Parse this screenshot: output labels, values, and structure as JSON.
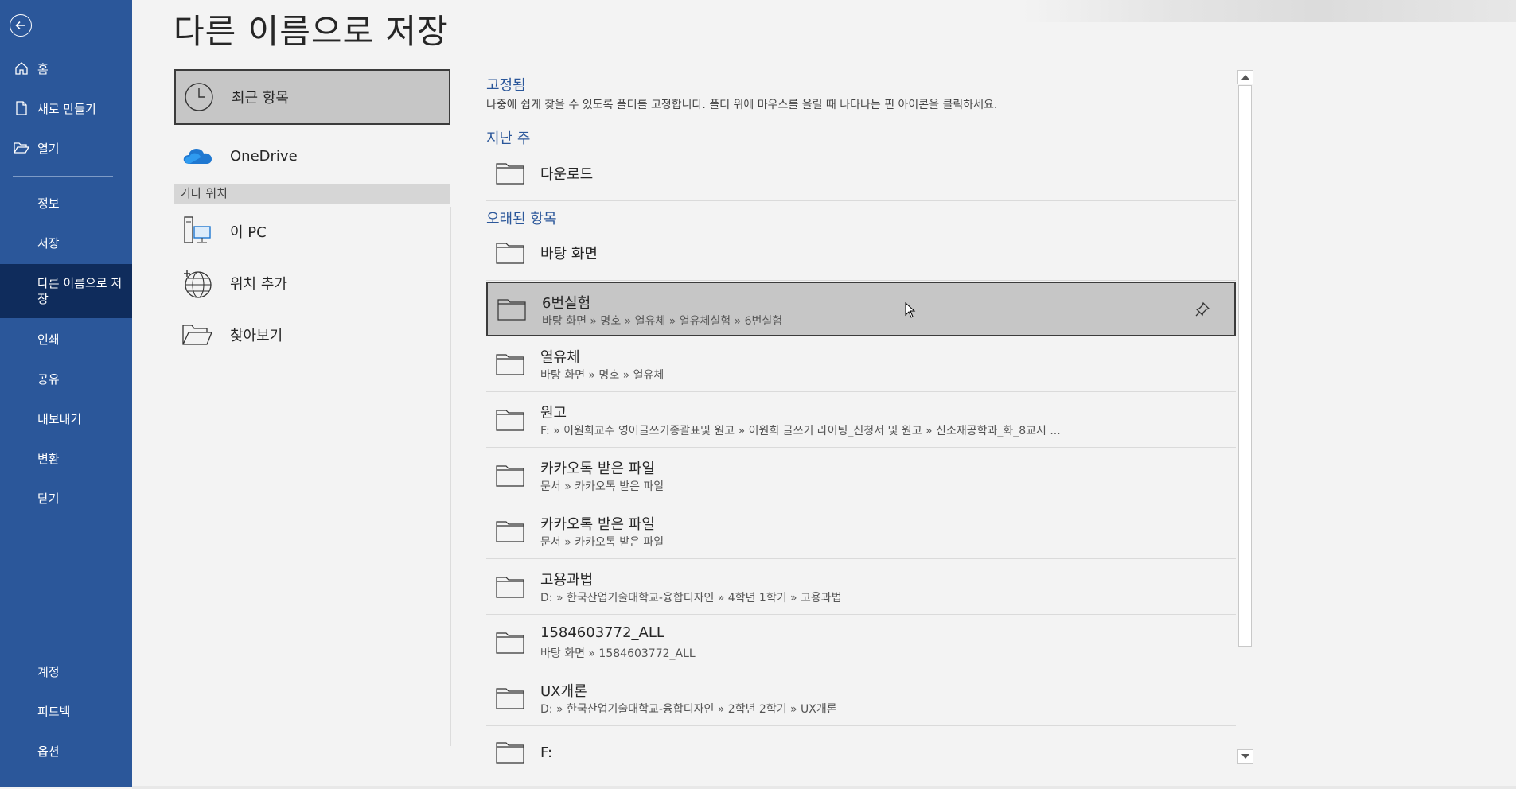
{
  "page": {
    "title": "다른 이름으로 저장"
  },
  "nav": {
    "back_icon": "back-arrow-icon",
    "items_top": [
      {
        "label": "홈",
        "icon": "home-icon"
      },
      {
        "label": "새로 만들기",
        "icon": "new-document-icon"
      },
      {
        "label": "열기",
        "icon": "open-folder-icon"
      }
    ],
    "items_mid": [
      {
        "label": "정보"
      },
      {
        "label": "저장"
      },
      {
        "label": "다른 이름으로 저장",
        "active": true
      },
      {
        "label": "인쇄"
      },
      {
        "label": "공유"
      },
      {
        "label": "내보내기"
      },
      {
        "label": "변환"
      },
      {
        "label": "닫기"
      }
    ],
    "items_bottom": [
      {
        "label": "계정"
      },
      {
        "label": "피드백"
      },
      {
        "label": "옵션"
      }
    ]
  },
  "locations": {
    "recent": {
      "label": "최근 항목",
      "icon": "clock-icon"
    },
    "onedrive": {
      "label": "OneDrive",
      "icon": "onedrive-cloud-icon"
    },
    "other_header": "기타 위치",
    "this_pc": {
      "label": "이 PC",
      "icon": "pc-icon"
    },
    "add_place": {
      "label": "위치 추가",
      "icon": "globe-add-icon"
    },
    "browse": {
      "label": "찾아보기",
      "icon": "folder-open-icon"
    }
  },
  "recent": {
    "pinned_title": "고정됨",
    "pinned_desc": "나중에 쉽게 찾을 수 있도록 폴더를 고정합니다. 폴더 위에 마우스를 올릴 때 나타나는 핀 아이콘을 클릭하세요.",
    "last_week_title": "지난 주",
    "older_title": "오래된 항목",
    "last_week": [
      {
        "name": "다운로드"
      }
    ],
    "older": [
      {
        "name": "바탕 화면"
      },
      {
        "name": "6번실험",
        "path": "바탕 화면 » 명호 » 열유체 » 열유체실험 » 6번실험",
        "hover": true
      },
      {
        "name": "열유체",
        "path": "바탕 화면 » 명호 » 열유체"
      },
      {
        "name": "원고",
        "path": "F: » 이원희교수 영어글쓰기종괄표및 원고 » 이원희 글쓰기 라이팅_신청서 및 원고 » 신소재공학과_화_8교시 ..."
      },
      {
        "name": "카카오톡 받은 파일",
        "path": "문서 » 카카오톡 받은 파일"
      },
      {
        "name": "카카오톡 받은 파일",
        "path": "문서 » 카카오톡 받은 파일"
      },
      {
        "name": "고용과법",
        "path": "D: » 한국산업기술대학교-융합디자인 » 4학년 1학기 » 고용과법"
      },
      {
        "name": "1584603772_ALL",
        "path": "바탕 화면 » 1584603772_ALL"
      },
      {
        "name": "UX개론",
        "path": "D: » 한국산업기술대학교-융합디자인 » 2학년 2학기 » UX개론"
      },
      {
        "name": "F:"
      }
    ]
  },
  "colors": {
    "nav_bg": "#2b579a",
    "nav_active": "#0f2c5c",
    "accent": "#2b579a",
    "selected_bg": "#c6c6c6"
  }
}
